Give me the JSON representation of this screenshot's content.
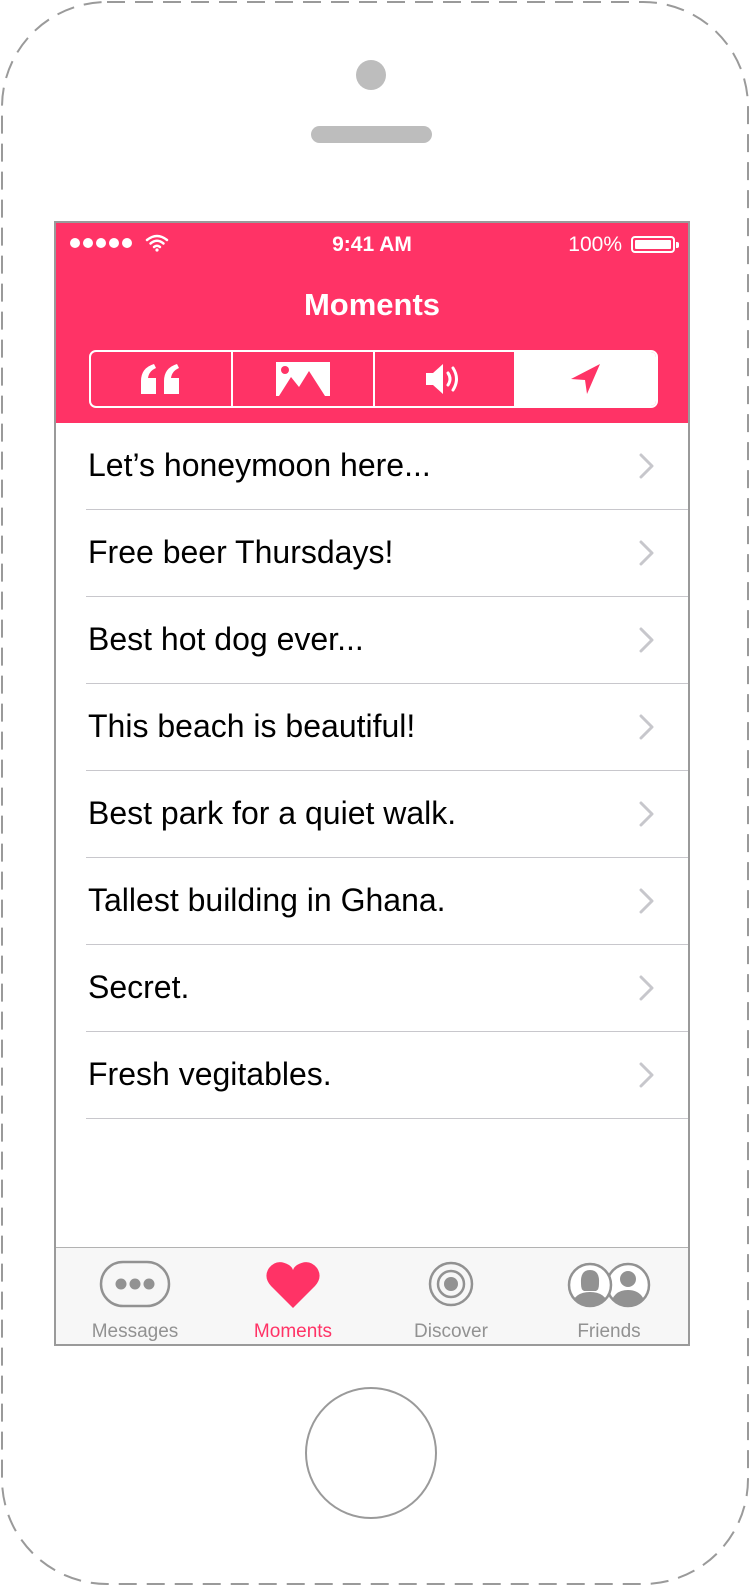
{
  "status_bar": {
    "time": "9:41 AM",
    "battery": "100%"
  },
  "nav": {
    "title": "Moments"
  },
  "segments": [
    {
      "icon": "quote-icon",
      "active": false
    },
    {
      "icon": "image-icon",
      "active": false
    },
    {
      "icon": "speaker-icon",
      "active": false
    },
    {
      "icon": "location-arrow-icon",
      "active": true
    }
  ],
  "list": {
    "items": [
      {
        "label": "Let’s honeymoon here..."
      },
      {
        "label": "Free beer Thursdays!"
      },
      {
        "label": "Best hot dog ever..."
      },
      {
        "label": "This beach is beautiful!"
      },
      {
        "label": "Best park for a quiet walk."
      },
      {
        "label": "Tallest building in Ghana."
      },
      {
        "label": "Secret."
      },
      {
        "label": "Fresh vegitables."
      }
    ]
  },
  "tab_bar": {
    "tabs": [
      {
        "label": "Messages",
        "icon": "chat-bubble-icon",
        "active": false
      },
      {
        "label": "Moments",
        "icon": "heart-icon",
        "active": true
      },
      {
        "label": "Discover",
        "icon": "target-icon",
        "active": false
      },
      {
        "label": "Friends",
        "icon": "friends-icon",
        "active": false
      }
    ]
  },
  "colors": {
    "accent": "#ff3366",
    "inactive": "#929292",
    "separator": "#c8c7cc"
  }
}
